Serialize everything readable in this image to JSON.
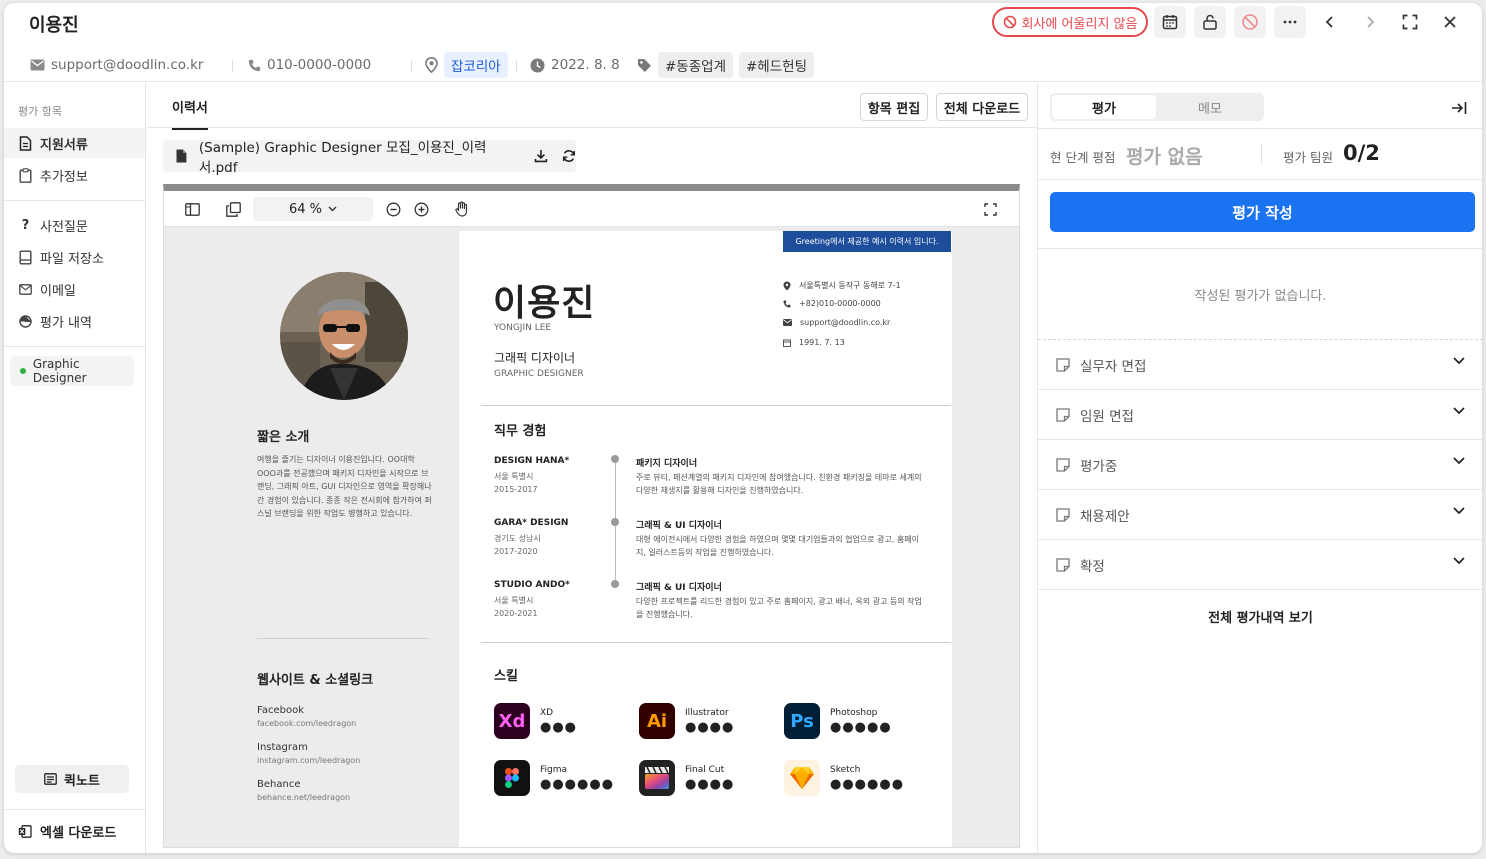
{
  "header": {
    "candidate_name": "이용진",
    "unfit_label": "회사에 어울리지 않음"
  },
  "info": {
    "email": "support@doodlin.co.kr",
    "phone": "010-0000-0000",
    "source": "잡코리아",
    "date": "2022. 8. 8",
    "tags": [
      "#동종업계",
      "#헤드헌팅"
    ]
  },
  "sidebar": {
    "caption": "평가 항목",
    "items": [
      "지원서류",
      "추가정보",
      "사전질문",
      "파일 저장소",
      "이메일",
      "평가 내역"
    ],
    "position": "Graphic Designer",
    "quicknote": "퀵노트",
    "excel": "엑셀 다운로드"
  },
  "center": {
    "tab": "이력서",
    "edit_button": "항목 편집",
    "download_all_button": "전체 다운로드",
    "file_name": "(Sample) Graphic Designer 모집_이용진_이력서.pdf",
    "zoom": "64 %"
  },
  "resume": {
    "greeting": "Greeting에서 제공한 예시 이력서 입니다.",
    "name": "이용진",
    "name_en": "YONGJIN LEE",
    "role": "그래픽 디자이너",
    "role_en": "GRAPHIC DESIGNER",
    "contacts": [
      "서울특별시 동작구 동해로 7-1",
      "+82)010-0000-0000",
      "support@doodlin.co.kr",
      "1991. 7. 13"
    ],
    "intro_title": "짧은 소개",
    "intro": "여행을 즐기는 디자이너 이용진입니다. OO대학 OOO과를 전공했으며 패키지 디자인을 시작으로 브랜딩, 그래픽 아트, GUI 디자인으로 영역을 확장해나간 경험이 있습니다. 종종 작은 전시회에 참가하여 퍼스널 브랜딩을 위한 작업도 병행하고 있습니다.",
    "social_title": "웹사이트 & 소셜링크",
    "socials": [
      {
        "name": "Facebook",
        "url": "facebook.com/leedragon"
      },
      {
        "name": "Instagram",
        "url": "instagram.com/leedragon"
      },
      {
        "name": "Behance",
        "url": "behance.net/leedragon"
      }
    ],
    "exp_title": "직무 경험",
    "experience": [
      {
        "company": "DESIGN HANA*",
        "location": "서울 특별시",
        "period": "2015-2017",
        "title": "패키지 디자이너",
        "desc": "주로 뷰티, 패션계열의 패키지 디자인에 참여했습니다. 친환경 패키징을 테마로 세계의 다양한 재생지를 활용해 디자인을 진행하였습니다."
      },
      {
        "company": "GARA* DESIGN",
        "location": "경기도 성남시",
        "period": "2017-2020",
        "title": "그래픽 & UI 디자이너",
        "desc": "대형 에이전시에서 다양한 경험을 하였으며 몇몇 대기업들과의 협업으로 광고, 홈페이지, 일러스트등의 작업을 진행하였습니다."
      },
      {
        "company": "STUDIO ANDO*",
        "location": "서울 특별시",
        "period": "2020-2021",
        "title": "그래픽 & UI 디자이너",
        "desc": "다양한 프로젝트를 리드한 경험이 있고 주로 홈페이지, 광고 배너, 옥외 광고 등의 작업을 진행했습니다."
      }
    ],
    "skill_title": "스킬",
    "skills": [
      {
        "name": "XD",
        "abbr": "Xd",
        "level": 3
      },
      {
        "name": "Illustrator",
        "abbr": "Ai",
        "level": 4
      },
      {
        "name": "Photoshop",
        "abbr": "Ps",
        "level": 5
      },
      {
        "name": "Figma",
        "abbr": "",
        "level": 6
      },
      {
        "name": "Final Cut",
        "abbr": "",
        "level": 4
      },
      {
        "name": "Sketch",
        "abbr": "",
        "level": 6
      }
    ]
  },
  "evaluation": {
    "tab_eval": "평가",
    "tab_memo": "메모",
    "stage_label": "현 단계 평점",
    "stage_value": "평가 없음",
    "members_label": "평가 팀원",
    "members_value": "0/2",
    "write_button": "평가 작성",
    "empty_text": "작성된 평가가 없습니다.",
    "stages": [
      "실무자 면접",
      "임원 면접",
      "평가중",
      "채용제안",
      "확정"
    ],
    "view_all": "전체 평가내역 보기"
  },
  "colors": {
    "primary": "#1a73f0",
    "danger": "#e5484d",
    "resume_accent": "#1e4d9c"
  }
}
